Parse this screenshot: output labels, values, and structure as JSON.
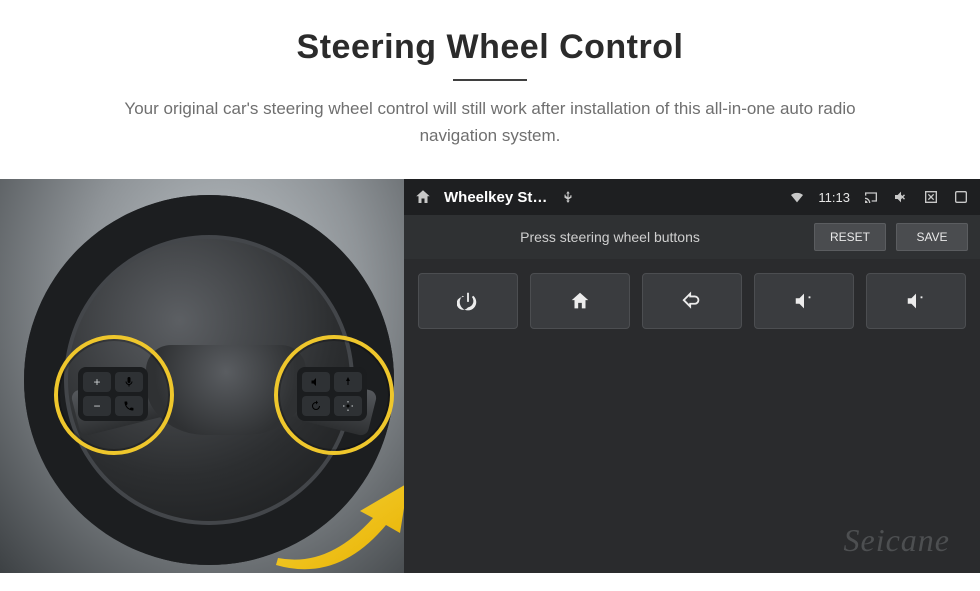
{
  "hero": {
    "title": "Steering Wheel Control",
    "subtitle": "Your original car's steering wheel control will still work after installation of this all-in-one auto radio navigation system."
  },
  "wheel_pad": {
    "left": [
      "+",
      "mic",
      "−",
      "phone"
    ],
    "right": [
      "horn",
      "nav",
      "loop",
      "target"
    ]
  },
  "statusbar": {
    "app_title": "Wheelkey St…",
    "time": "11:13",
    "icons": {
      "home": "home-icon",
      "usb": "usb-icon",
      "wifi": "wifi-icon",
      "cast": "cast-icon",
      "mute": "mute-icon",
      "close": "close-icon",
      "recents": "recents-icon"
    }
  },
  "toolbar": {
    "prompt": "Press steering wheel buttons",
    "reset_label": "RESET",
    "save_label": "SAVE"
  },
  "tiles": [
    {
      "name": "power",
      "glyph": "power"
    },
    {
      "name": "home",
      "glyph": "home"
    },
    {
      "name": "back",
      "glyph": "back"
    },
    {
      "name": "vol-up-1",
      "glyph": "volup"
    },
    {
      "name": "vol-up-2",
      "glyph": "volup"
    }
  ],
  "watermark": "Seicane"
}
